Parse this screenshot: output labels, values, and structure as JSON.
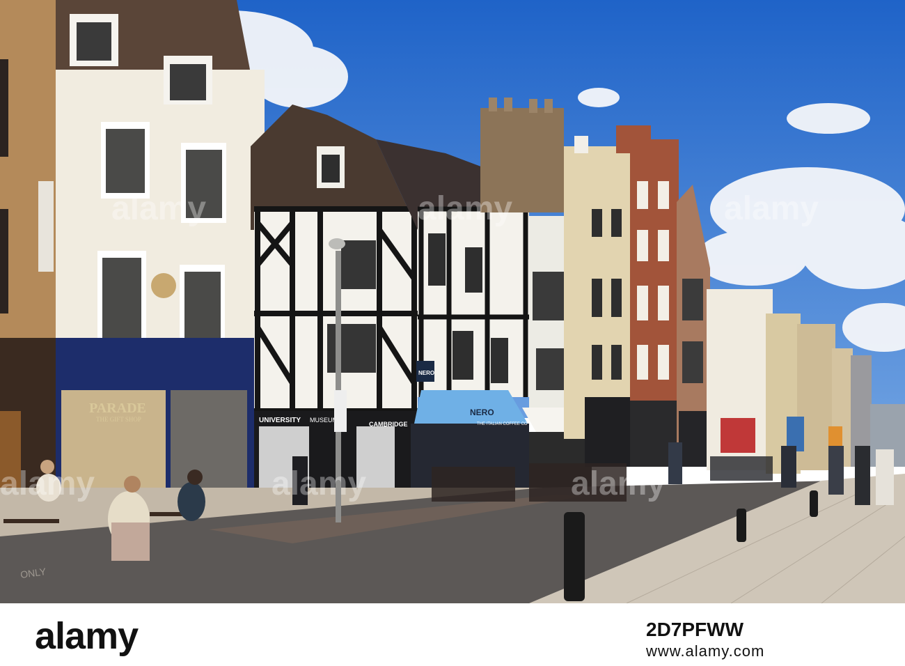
{
  "photo": {
    "shop_signs": {
      "parade": "PARADE",
      "gift_shop": "THE GIFT SHOP",
      "university": "UNIVERSITY",
      "museums": "MUSEUMS",
      "cambridge": "CAMBRIDGE",
      "nero_hanging": "NERO",
      "nero_awning": "NERO",
      "coffee_tagline": "THE ITALIAN COFFEE CO",
      "only_road": "ONLY"
    },
    "watermark": "alamy"
  },
  "footer": {
    "logo": "alamy",
    "image_id": "2D7PFWW",
    "url": "www.alamy.com"
  }
}
